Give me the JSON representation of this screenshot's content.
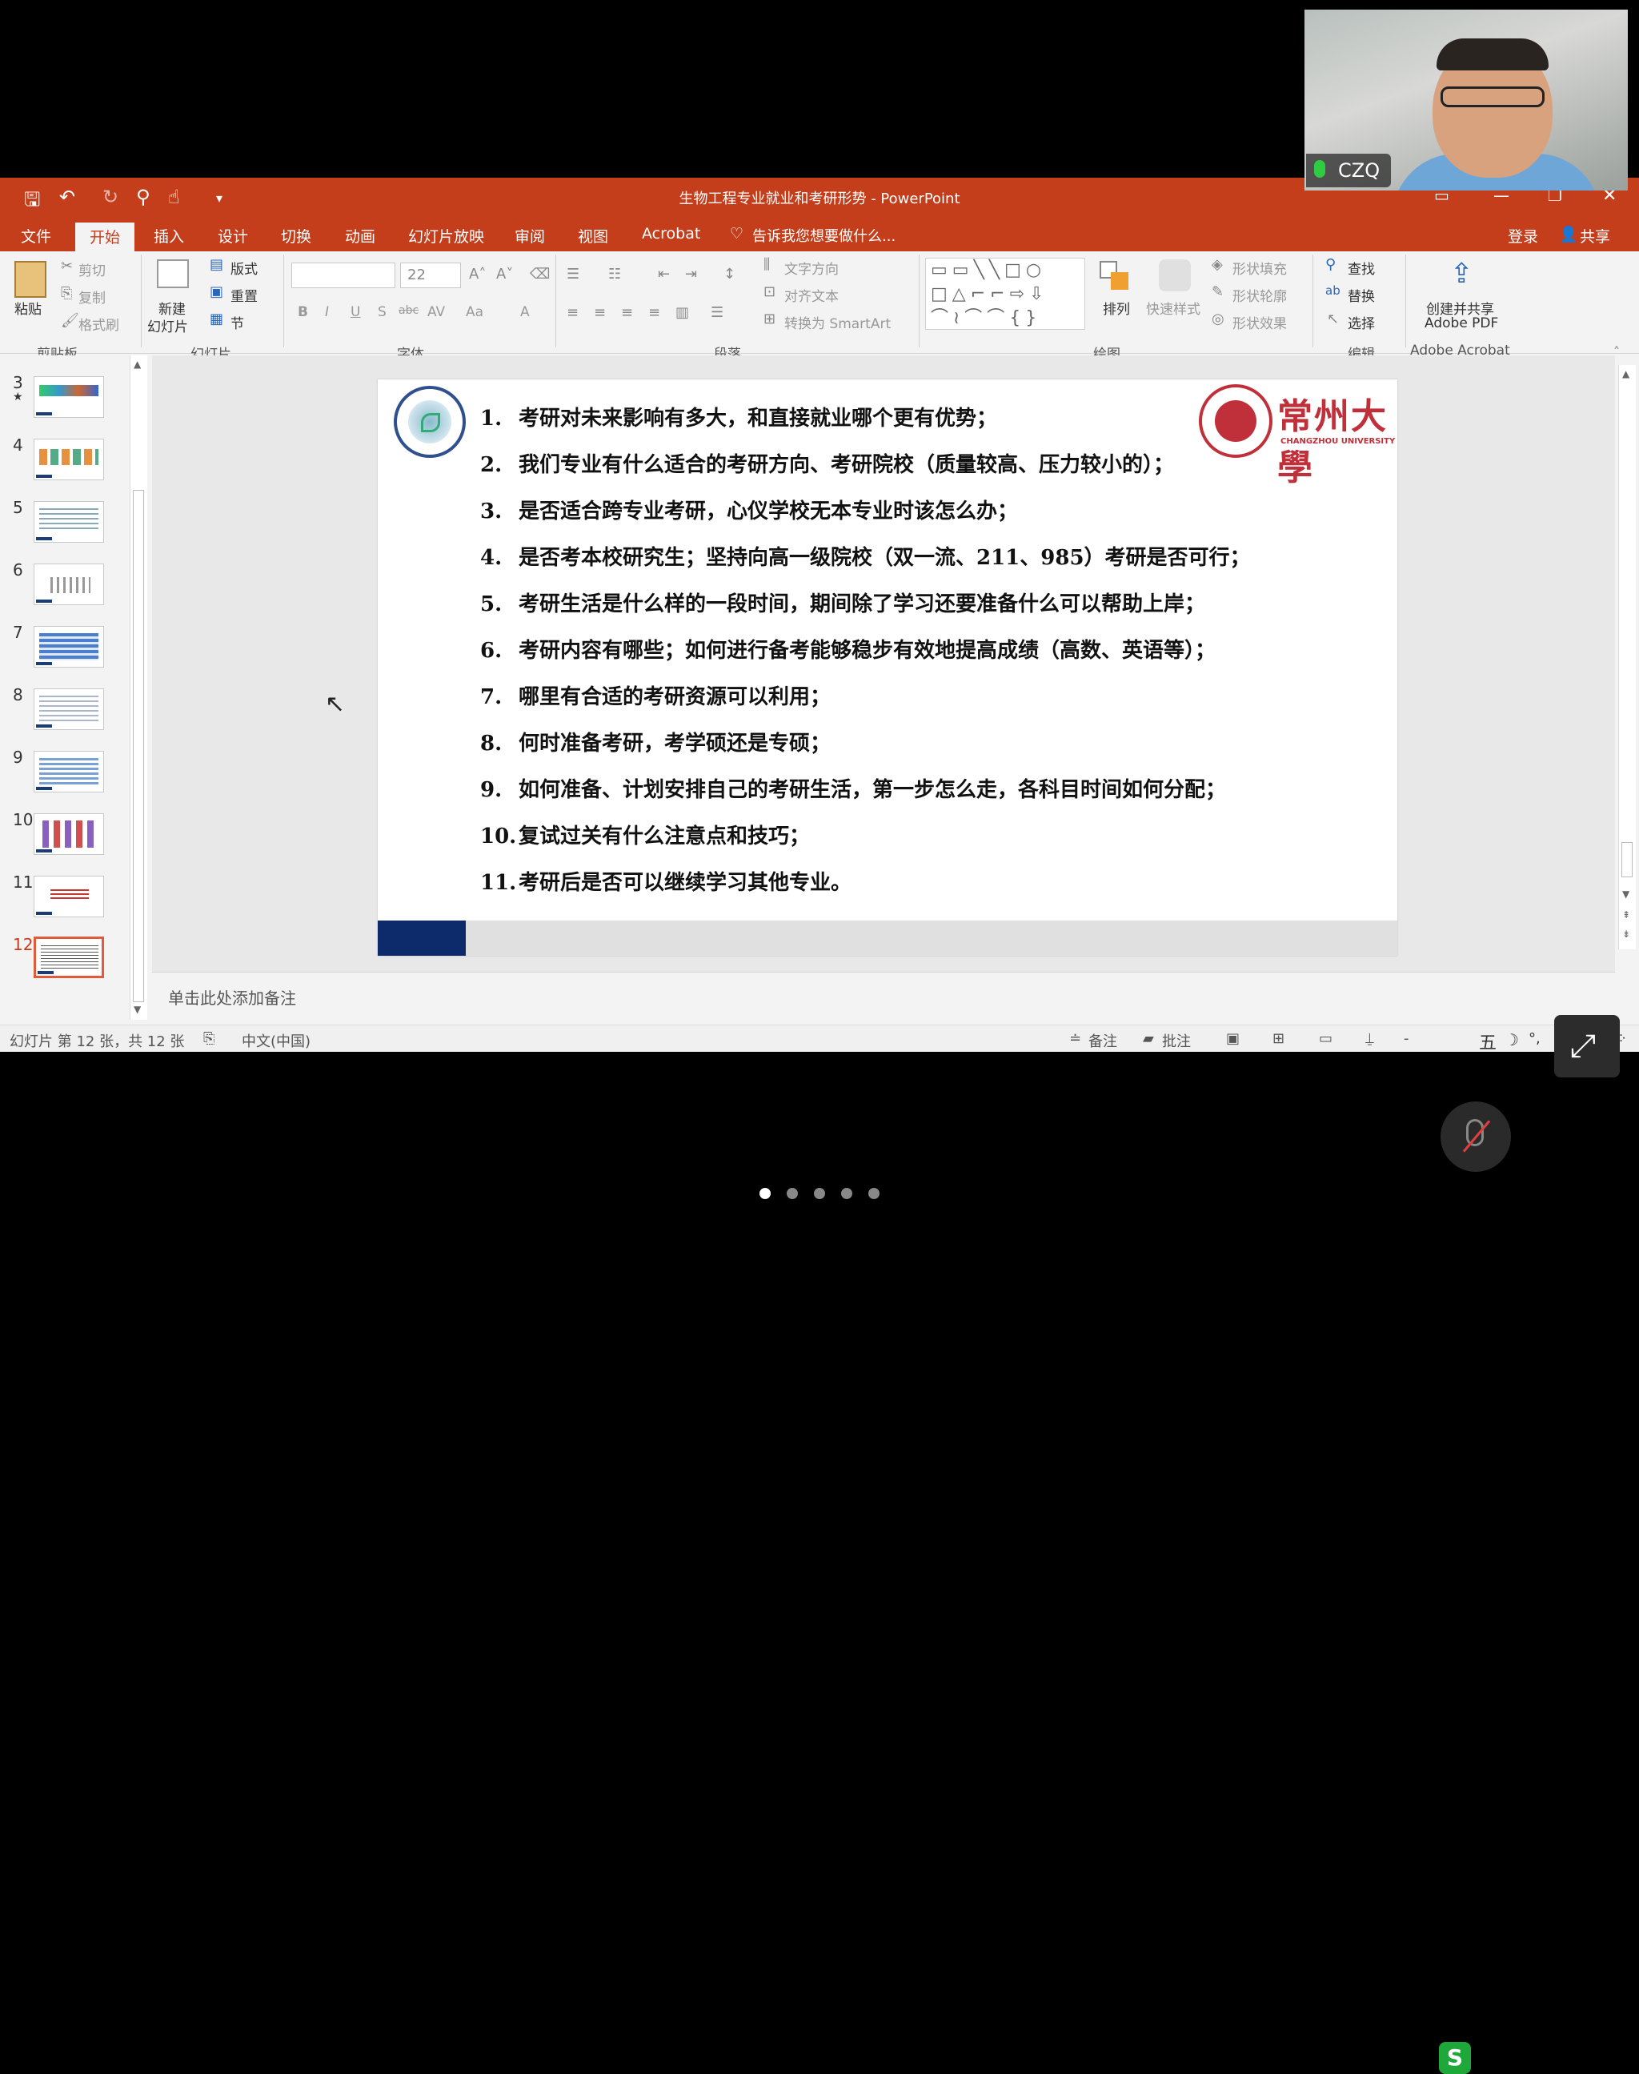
{
  "window": {
    "title": "生物工程专业就业和考研形势 - PowerPoint"
  },
  "tabs": [
    "文件",
    "开始",
    "插入",
    "设计",
    "切换",
    "动画",
    "幻灯片放映",
    "审阅",
    "视图",
    "Acrobat"
  ],
  "active_tab": "开始",
  "tell_me": "告诉我您想要做什么...",
  "account": {
    "login": "登录",
    "share": "共享"
  },
  "ribbon": {
    "clipboard": {
      "paste": "粘贴",
      "cut": "剪切",
      "copy": "复制",
      "format_painter": "格式刷",
      "group": "剪贴板"
    },
    "slides": {
      "new_slide_line1": "新建",
      "new_slide_line2": "幻灯片",
      "layout": "版式",
      "reset": "重置",
      "section": "节",
      "group": "幻灯片"
    },
    "font": {
      "font_size": "22",
      "group": "字体",
      "bold": "B",
      "italic": "I",
      "underline": "U",
      "shadow": "S",
      "strike": "abc",
      "spacing": "AV",
      "case": "Aa",
      "color": "A"
    },
    "paragraph": {
      "text_direction": "文字方向",
      "align_text": "对齐文本",
      "smartart": "转换为 SmartArt",
      "group": "段落"
    },
    "drawing": {
      "arrange": "排列",
      "quick_styles": "快速样式",
      "shape_fill": "形状填充",
      "shape_outline": "形状轮廓",
      "shape_effects": "形状效果",
      "group": "绘图"
    },
    "editing": {
      "find": "查找",
      "replace": "替换",
      "select": "选择",
      "group": "编辑"
    },
    "acrobat": {
      "create_line1": "创建并共享",
      "create_line2": "Adobe PDF",
      "group": "Adobe Acrobat"
    }
  },
  "thumbnails": [
    {
      "num": "3",
      "star": "★"
    },
    {
      "num": "4"
    },
    {
      "num": "5"
    },
    {
      "num": "6"
    },
    {
      "num": "7"
    },
    {
      "num": "8"
    },
    {
      "num": "9"
    },
    {
      "num": "10"
    },
    {
      "num": "11"
    },
    {
      "num": "12"
    }
  ],
  "slide": {
    "logo_right_text": "常州大學",
    "logo_right_sub": "CHANGZHOU UNIVERSITY",
    "items": [
      {
        "n": "1.",
        "text": "考研对未来影响有多大，和直接就业哪个更有优势；"
      },
      {
        "n": "2.",
        "text": "我们专业有什么适合的考研方向、考研院校（质量较高、压力较小的）；"
      },
      {
        "n": "3.",
        "text": "是否适合跨专业考研，心仪学校无本专业时该怎么办；"
      },
      {
        "n": "4.",
        "text": "是否考本校研究生；坚持向高一级院校（双一流、211、985）考研是否可行；"
      },
      {
        "n": "5.",
        "text": "考研生活是什么样的一段时间，期间除了学习还要准备什么可以帮助上岸；"
      },
      {
        "n": "6.",
        "text": "考研内容有哪些；如何进行备考能够稳步有效地提高成绩（高数、英语等）；"
      },
      {
        "n": "7.",
        "text": "哪里有合适的考研资源可以利用；"
      },
      {
        "n": "8.",
        "text": "何时准备考研，考学硕还是专硕；"
      },
      {
        "n": "9.",
        "text": "如何准备、计划安排自己的考研生活，第一步怎么走，各科目时间如何分配；"
      },
      {
        "n": "10.",
        "text": "复试过关有什么注意点和技巧；"
      },
      {
        "n": "11.",
        "text": "考研后是否可以继续学习其他专业。"
      }
    ]
  },
  "notes_placeholder": "单击此处添加备注",
  "status": {
    "slide_info": "幻灯片 第 12 张，共 12 张",
    "language": "中文(中国)",
    "notes": "备注",
    "comments": "批注",
    "ime": "五"
  },
  "webcam": {
    "name": "CZQ"
  },
  "pager": {
    "count": 5,
    "active": 0
  },
  "colors": {
    "accent": "#c43e1c",
    "footer_blue": "#0d2a6b"
  }
}
